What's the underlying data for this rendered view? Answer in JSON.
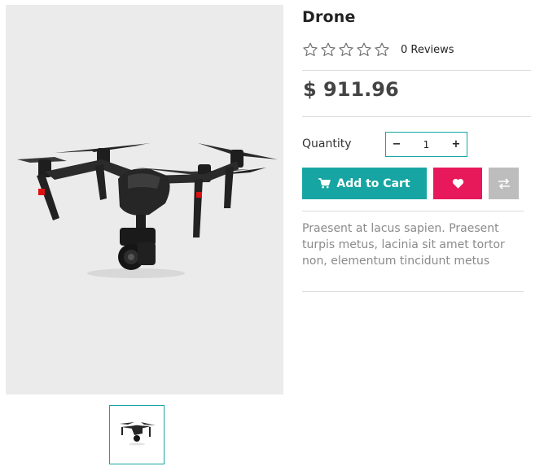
{
  "product": {
    "title": "Drone",
    "rating": {
      "stars_filled": 0,
      "stars_total": 5,
      "reviews_label": "0 Reviews"
    },
    "price": "$ 911.96",
    "quantity": {
      "label": "Quantity",
      "value": "1",
      "decrement_symbol": "−",
      "increment_symbol": "+"
    },
    "actions": {
      "add_to_cart_label": "Add to Cart",
      "add_to_cart_icon": "shopping-cart-icon",
      "wishlist_icon": "heart-icon",
      "compare_icon": "compare-arrows-icon"
    },
    "description": "Praesent at lacus sapien. Praesent turpis metus, lacinia sit amet tortor non, elementum tincidunt metus"
  },
  "gallery": {
    "main_image": "drone-product-photo",
    "thumbnails": [
      "drone-thumbnail"
    ]
  },
  "colors": {
    "accent": "#16a5a2",
    "wishlist": "#e8195a",
    "compare": "#bdbdbd",
    "image_background": "#ebebeb"
  }
}
